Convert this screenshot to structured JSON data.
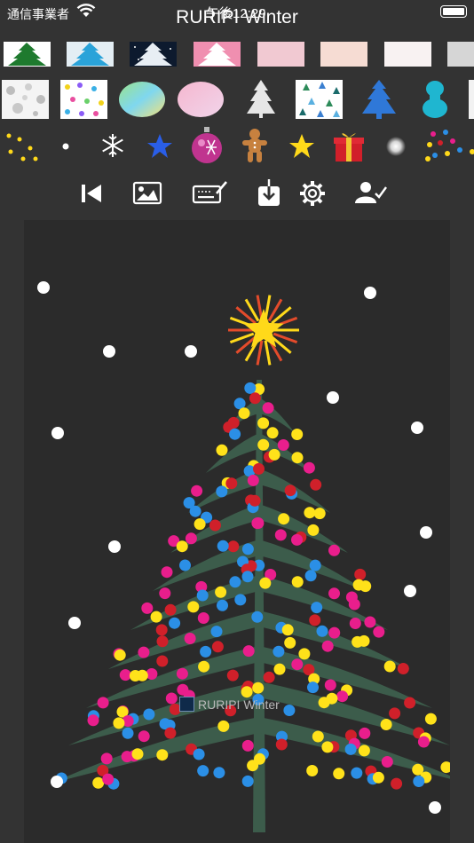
{
  "status_bar": {
    "carrier": "通信事業者",
    "time": "午後12:29"
  },
  "app": {
    "title": "RURIPI Winter"
  },
  "palette": {
    "row1": [
      "green-tree-paper",
      "blue-tree-paper",
      "night-tree-paper",
      "pink-tree-paper",
      "pink-paper",
      "peach-paper",
      "white-paper",
      "gray-paper"
    ],
    "row2": [
      "gray-dots-paper",
      "confetti-paper",
      "rainbow-ellipse",
      "pink-ellipse",
      "white-tree",
      "triangle-pattern-paper",
      "blue-glitter-tree",
      "teal-ornament"
    ],
    "row3": [
      "yellow-dots",
      "white-dot",
      "snowflake",
      "blue-star",
      "purple-bauble",
      "gingerbread-man",
      "yellow-star",
      "gift-box",
      "glow-light",
      "colored-dots"
    ]
  },
  "toolbar": [
    "back-to-start",
    "image",
    "keyboard-edit",
    "save-download",
    "settings",
    "account"
  ],
  "canvas": {
    "watermark": "RURIPI Winter",
    "colors": {
      "tree": "#3c5c4b",
      "star": "#ffd91a",
      "ornaments": [
        "#ffe21a",
        "#e91e8c",
        "#2b8fe6",
        "#d0202a"
      ],
      "snow": "#ffffff"
    }
  }
}
